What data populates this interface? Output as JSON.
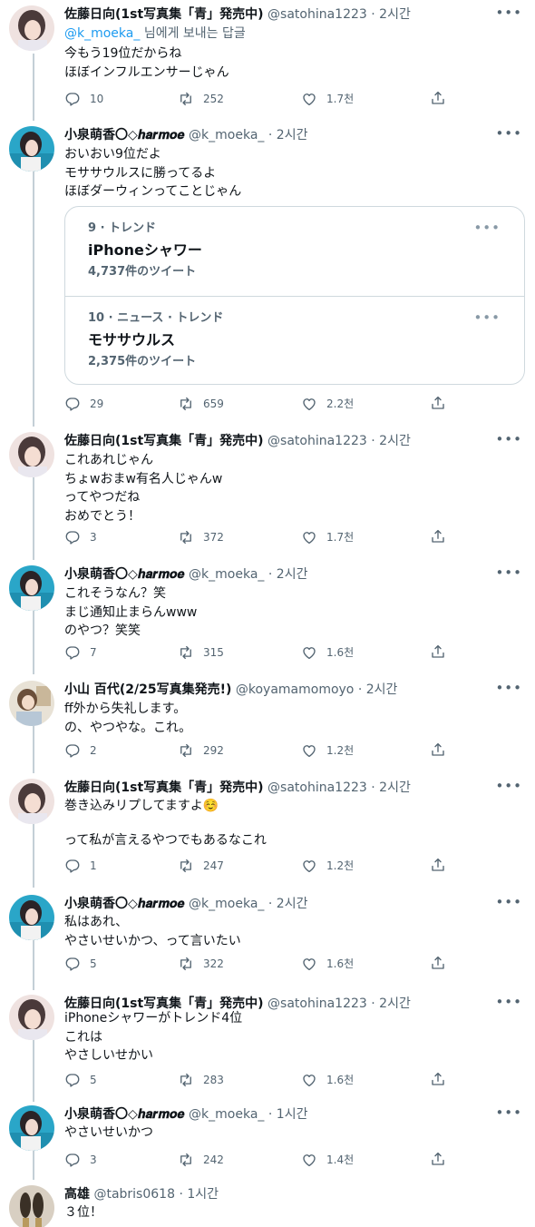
{
  "tweets": [
    {
      "name": "佐藤日向(1st写真集「青」発売中)",
      "handle": "@satohina1223",
      "time": "2시간",
      "reply_to_mention": "@k_moeka_",
      "reply_to_suffix": " 님에게 보내는 답글",
      "lines": [
        "今もう19位だからね",
        "ほぼインフルエンサーじゃん"
      ],
      "replies": "10",
      "retweets": "252",
      "likes": "1.7천"
    },
    {
      "name": "小泉萌香〇◇𝒉𝒂𝒓𝒎𝒐𝒆",
      "handle": "@k_moeka_",
      "time": "2시간",
      "lines": [
        "おいおい9位だよ",
        "モササウルスに勝ってるよ",
        "ほぼダーウィンってことじゃん"
      ],
      "replies": "29",
      "retweets": "659",
      "likes": "2.2천"
    },
    {
      "name": "佐藤日向(1st写真集「青」発売中)",
      "handle": "@satohina1223",
      "time": "2시간",
      "lines": [
        "これあれじゃん",
        "ちょwおまw有名人じゃんw",
        "ってやつだね",
        "おめでとう！"
      ],
      "replies": "3",
      "retweets": "372",
      "likes": "1.7천"
    },
    {
      "name": "小泉萌香〇◇𝒉𝒂𝒓𝒎𝒐𝒆",
      "handle": "@k_moeka_",
      "time": "2시간",
      "lines": [
        "これそうなん？笑",
        "まじ通知止まらんwww",
        "のやつ？笑笑"
      ],
      "replies": "7",
      "retweets": "315",
      "likes": "1.6천"
    },
    {
      "name": "小山 百代(2/25写真集発売!)",
      "handle": "@koyamamomoyo",
      "time": "2시간",
      "lines": [
        "ff外から失礼します。",
        "の、やつやな。これ。"
      ],
      "replies": "2",
      "retweets": "292",
      "likes": "1.2천"
    },
    {
      "name": "佐藤日向(1st写真集「青」発売中)",
      "handle": "@satohina1223",
      "time": "2시간",
      "lines": [
        "巻き込みリプしてますよ☺️",
        "",
        "って私が言えるやつでもあるなこれ"
      ],
      "replies": "1",
      "retweets": "247",
      "likes": "1.2천"
    },
    {
      "name": "小泉萌香〇◇𝒉𝒂𝒓𝒎𝒐𝒆",
      "handle": "@k_moeka_",
      "time": "2시간",
      "lines": [
        "私はあれ、",
        "やさいせいかつ、って言いたい"
      ],
      "replies": "5",
      "retweets": "322",
      "likes": "1.6천"
    },
    {
      "name": "佐藤日向(1st写真集「青」発売中)",
      "handle": "@satohina1223",
      "time": "2시간",
      "lines": [
        "iPhoneシャワーがトレンド4位",
        "これは",
        "やさしいせかい"
      ],
      "replies": "5",
      "retweets": "283",
      "likes": "1.6천"
    },
    {
      "name": "小泉萌香〇◇𝒉𝒂𝒓𝒎𝒐𝒆",
      "handle": "@k_moeka_",
      "time": "1시간",
      "lines": [
        "やさいせいかつ"
      ],
      "replies": "3",
      "retweets": "242",
      "likes": "1.4천"
    },
    {
      "name": "高雄",
      "handle": "@tabris0618",
      "time": "1시간",
      "lines": [
        "３位！"
      ]
    }
  ],
  "dot": "·",
  "more": "•••",
  "trend_card": [
    {
      "meta": "9 · トレンド",
      "title": "iPhoneシャワー",
      "count": "4,737件のツイート"
    },
    {
      "meta": "10 · ニュース · トレンド",
      "title": "モササウルス",
      "count": "2,375件のツイート"
    }
  ],
  "icons": {
    "reply": "reply-icon",
    "retweet": "retweet-icon",
    "like": "heart-icon",
    "share": "share-icon",
    "more": "more-icon"
  },
  "colors": {
    "accent": "#1d9bf0",
    "text": "#0f1419",
    "secondary": "#536471",
    "border": "#cfd9de",
    "thread_line": "#c4cfd6"
  }
}
